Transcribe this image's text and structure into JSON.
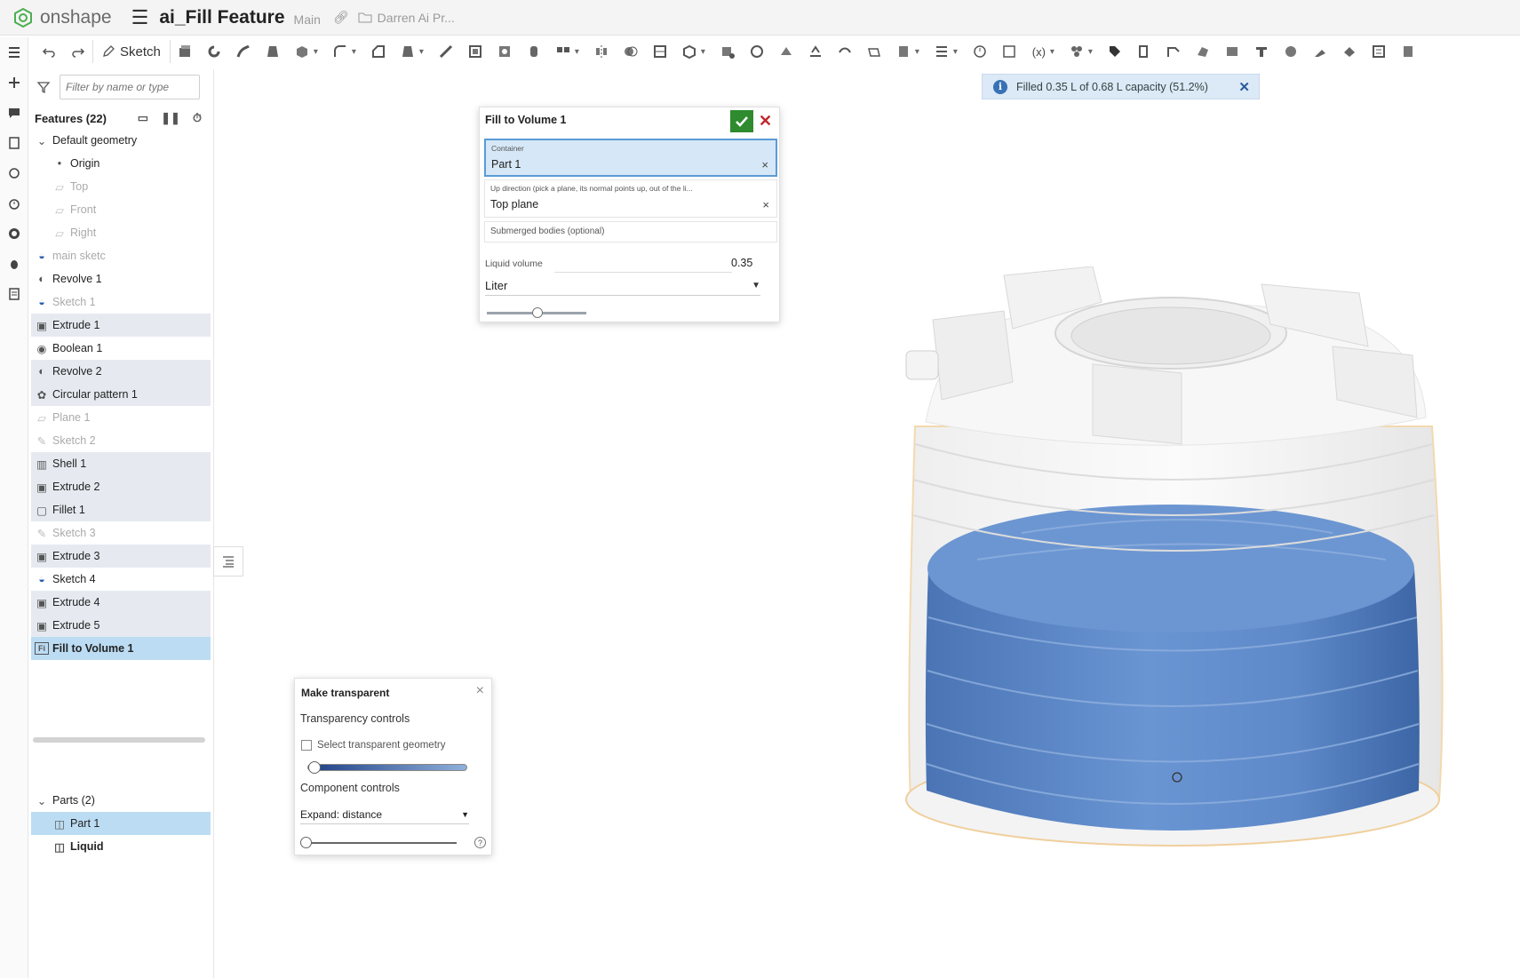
{
  "app": {
    "brand": "onshape",
    "doc_title": "ai_Fill Feature",
    "branch": "Main",
    "folder": "Darren Ai Pr..."
  },
  "toolbar": {
    "sketch_label": "Sketch"
  },
  "left_panel": {
    "filter_placeholder": "Filter by name or type",
    "features_header": "Features (22)",
    "tree": [
      {
        "label": "Default geometry",
        "kind": "group"
      },
      {
        "label": "Origin",
        "kind": "origin"
      },
      {
        "label": "Top",
        "kind": "plane"
      },
      {
        "label": "Front",
        "kind": "plane"
      },
      {
        "label": "Right",
        "kind": "plane"
      },
      {
        "label": "main sketc",
        "kind": "sketch"
      },
      {
        "label": "Revolve 1",
        "kind": "revolve"
      },
      {
        "label": "Sketch 1",
        "kind": "sketch"
      },
      {
        "label": "Extrude 1",
        "kind": "extrude"
      },
      {
        "label": "Boolean 1",
        "kind": "boolean"
      },
      {
        "label": "Revolve 2",
        "kind": "revolve"
      },
      {
        "label": "Circular pattern 1",
        "kind": "pattern"
      },
      {
        "label": "Plane 1",
        "kind": "plane"
      },
      {
        "label": "Sketch 2",
        "kind": "sketch"
      },
      {
        "label": "Shell 1",
        "kind": "shell"
      },
      {
        "label": "Extrude 2",
        "kind": "extrude"
      },
      {
        "label": "Fillet 1",
        "kind": "fillet"
      },
      {
        "label": "Sketch 3",
        "kind": "sketch"
      },
      {
        "label": "Extrude 3",
        "kind": "extrude"
      },
      {
        "label": "Sketch 4",
        "kind": "sketch"
      },
      {
        "label": "Extrude 4",
        "kind": "extrude"
      },
      {
        "label": "Extrude 5",
        "kind": "extrude"
      },
      {
        "label": "Fill to Volume 1",
        "kind": "custom"
      }
    ],
    "parts_header": "Parts (2)",
    "parts": [
      "Part 1",
      "Liquid"
    ]
  },
  "fill_dialog": {
    "title": "Fill to Volume 1",
    "container_label": "Container",
    "container_value": "Part 1",
    "up_label": "Up direction (pick a plane, its normal points up, out of the li...",
    "up_value": "Top plane",
    "submerged_label": "Submerged bodies (optional)",
    "liquid_volume_label": "Liquid volume",
    "liquid_volume_value": "0.35",
    "unit": "Liter",
    "slider_fraction": 0.51
  },
  "toast": {
    "message": "Filled 0.35 L of 0.68 L capacity (51.2%)"
  },
  "transparency": {
    "title": "Make transparent",
    "transparency_controls": "Transparency controls",
    "select_transparent": "Select transparent geometry",
    "component_controls": "Component controls",
    "expand_option": "Expand: distance"
  },
  "colors": {
    "accent": "#3672b5",
    "liquid": "#5b87c7",
    "selected_row": "#bcdcf3",
    "ok_green": "#2e8b2e",
    "cancel_red": "#c0262d"
  }
}
